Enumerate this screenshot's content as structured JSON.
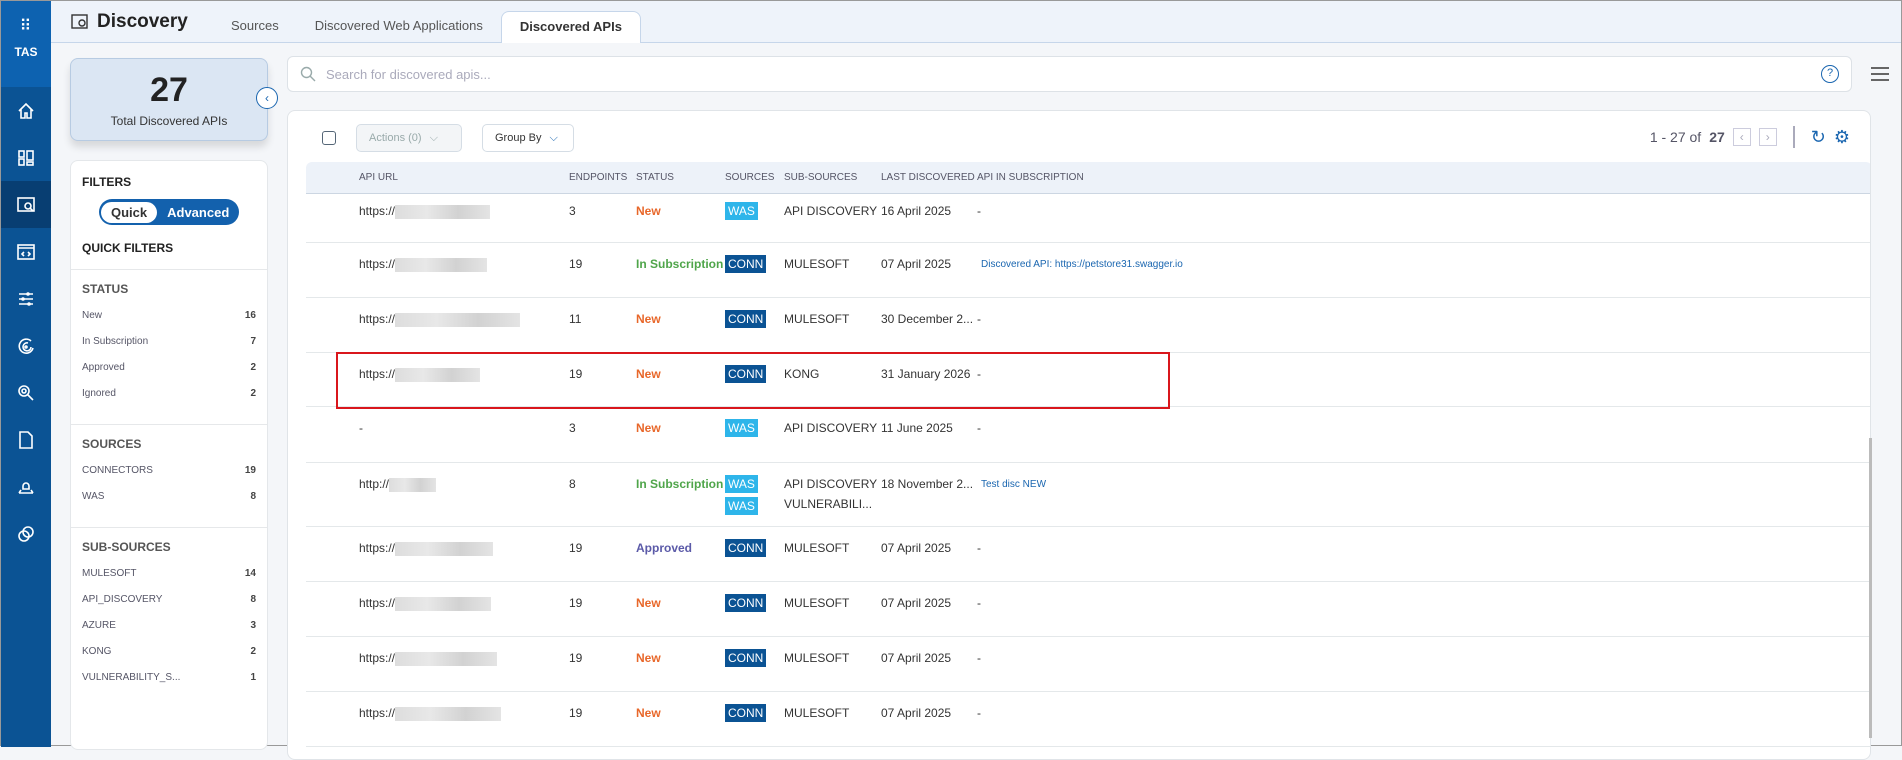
{
  "nav": {
    "brand": "TAS",
    "items": [
      "home",
      "dashboard",
      "discovery",
      "web-app",
      "settings-sliders",
      "radar",
      "search-target",
      "document",
      "deploy",
      "link"
    ]
  },
  "header": {
    "title": "Discovery",
    "tabs": [
      {
        "label": "Sources"
      },
      {
        "label": "Discovered Web Applications"
      },
      {
        "label": "Discovered APIs"
      }
    ]
  },
  "summary": {
    "count": "27",
    "label": "Total Discovered APIs"
  },
  "filters": {
    "title": "FILTERS",
    "mode_quick": "Quick",
    "mode_advanced": "Advanced",
    "quick_title": "QUICK FILTERS",
    "sections": [
      {
        "title": "STATUS",
        "items": [
          {
            "label": "New",
            "count": "16"
          },
          {
            "label": "In Subscription",
            "count": "7"
          },
          {
            "label": "Approved",
            "count": "2"
          },
          {
            "label": "Ignored",
            "count": "2"
          }
        ]
      },
      {
        "title": "SOURCES",
        "items": [
          {
            "label": "CONNECTORS",
            "count": "19"
          },
          {
            "label": "WAS",
            "count": "8"
          }
        ]
      },
      {
        "title": "SUB-SOURCES",
        "items": [
          {
            "label": "MULESOFT",
            "count": "14"
          },
          {
            "label": "API_DISCOVERY",
            "count": "8"
          },
          {
            "label": "AZURE",
            "count": "3"
          },
          {
            "label": "KONG",
            "count": "2"
          },
          {
            "label": "VULNERABILITY_S...",
            "count": "1"
          }
        ]
      }
    ]
  },
  "search": {
    "placeholder": "Search for discovered apis..."
  },
  "toolbar": {
    "actions": "Actions (0)",
    "group_by": "Group By",
    "pager_range": "1 - 27 of",
    "pager_total": "27"
  },
  "table": {
    "columns": [
      "API URL",
      "ENDPOINTS",
      "STATUS",
      "SOURCES",
      "SUB-SOURCES",
      "LAST DISCOVERED",
      "API IN SUBSCRIPTION"
    ],
    "rows": [
      {
        "url": "https://",
        "endpoints": "3",
        "status": "New",
        "sources": [
          "WAS"
        ],
        "subsources": [
          "API DISCOVERY"
        ],
        "last": "16 April 2025",
        "sub": "-"
      },
      {
        "url": "https://",
        "endpoints": "19",
        "status": "In Subscription",
        "sources": [
          "CONN"
        ],
        "subsources": [
          "MULESOFT"
        ],
        "last": "07 April 2025",
        "sub": "Discovered API: https://petstore31.swagger.io"
      },
      {
        "url": "https://",
        "endpoints": "11",
        "status": "New",
        "sources": [
          "CONN"
        ],
        "subsources": [
          "MULESOFT"
        ],
        "last": "30 December 2...",
        "sub": "-"
      },
      {
        "url": "https://",
        "endpoints": "19",
        "status": "New",
        "sources": [
          "CONN"
        ],
        "subsources": [
          "KONG"
        ],
        "last": "31 January 2026",
        "sub": "-"
      },
      {
        "url": "-",
        "endpoints": "3",
        "status": "New",
        "sources": [
          "WAS"
        ],
        "subsources": [
          "API DISCOVERY"
        ],
        "last": "11 June 2025",
        "sub": "-"
      },
      {
        "url": "http://",
        "endpoints": "8",
        "status": "In Subscription",
        "sources": [
          "WAS",
          "WAS"
        ],
        "subsources": [
          "API DISCOVERY",
          "VULNERABILI..."
        ],
        "last": "18 November 2...",
        "sub": "Test disc NEW"
      },
      {
        "url": "https://",
        "endpoints": "19",
        "status": "Approved",
        "sources": [
          "CONN"
        ],
        "subsources": [
          "MULESOFT"
        ],
        "last": "07 April 2025",
        "sub": "-"
      },
      {
        "url": "https://",
        "endpoints": "19",
        "status": "New",
        "sources": [
          "CONN"
        ],
        "subsources": [
          "MULESOFT"
        ],
        "last": "07 April 2025",
        "sub": "-"
      },
      {
        "url": "https://",
        "endpoints": "19",
        "status": "New",
        "sources": [
          "CONN"
        ],
        "subsources": [
          "MULESOFT"
        ],
        "last": "07 April 2025",
        "sub": "-"
      },
      {
        "url": "https://",
        "endpoints": "19",
        "status": "New",
        "sources": [
          "CONN"
        ],
        "subsources": [
          "MULESOFT"
        ],
        "last": "07 April 2025",
        "sub": "-"
      }
    ]
  },
  "colors": {
    "nav": "#0b5394",
    "new": "#e8672a",
    "in_subscription": "#4fa54a",
    "approved": "#5b5aa8",
    "was": "#2eb5ea",
    "conn": "#0b5394",
    "highlight": "#d9161c"
  }
}
